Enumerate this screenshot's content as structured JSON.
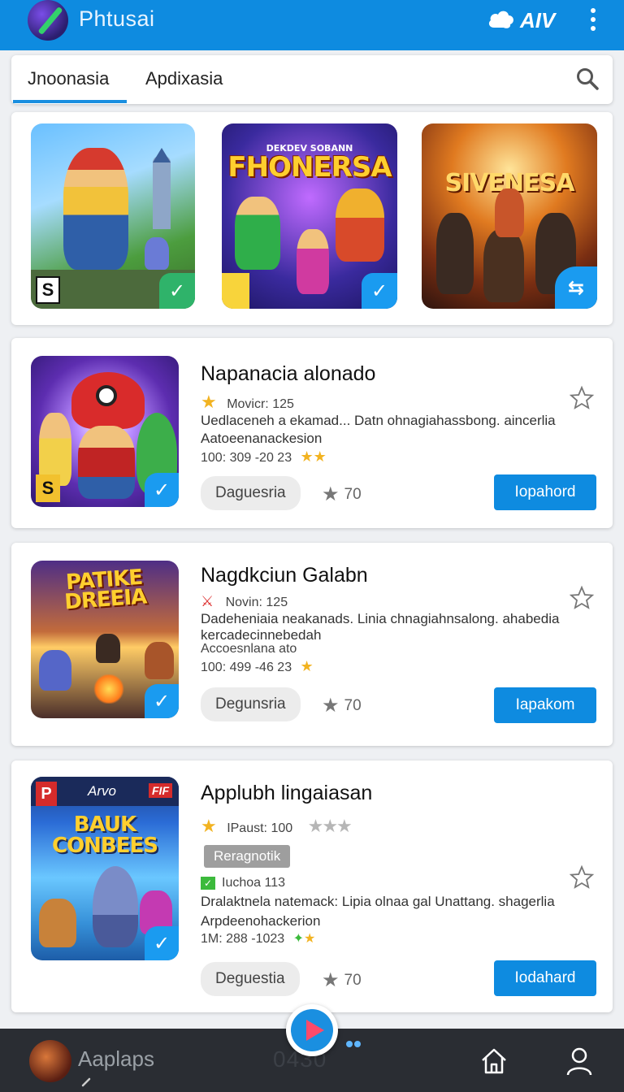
{
  "header": {
    "title": "Phtusai",
    "brand_mark": "AIV"
  },
  "tabs": [
    {
      "label": "Jnoonasia",
      "active": true
    },
    {
      "label": "Apdixasia",
      "active": false
    }
  ],
  "featured": {
    "tile2_subtitle": "DEKDEV SOBANN",
    "tile2_title": "FHONERSA",
    "tile3_title": "SIVENESA",
    "tile1_badge": "S"
  },
  "apps": [
    {
      "title": "Napanacia alonado",
      "meta": "Movicr: 125",
      "desc1": "Uedlaceneh a ekamad... Datn ohnagiahassbong. aincerlia",
      "desc2": "Aatoeenanackesion",
      "date": "100: 309 -20 23",
      "badge": "S",
      "tag": "Daguesria",
      "rating": "70",
      "action": "Iopahord"
    },
    {
      "title": "Nagdkciun Galabn",
      "thumb_title": "PATIKE DREEIA",
      "meta": "Novin: 125",
      "desc1": "Dadeheniaia neakanads. Linia chnagiahnsalong. ahabedia",
      "desc2": "kercadecinnebedah",
      "desc3": "Accoesnlana ato",
      "date": "100: 499 -46 23",
      "tag": "Degunsria",
      "rating": "70",
      "action": "Iapakom"
    },
    {
      "title": "Applubh lingaiasan",
      "thumb_header_logo": "P",
      "thumb_header_mid": "Arvo",
      "thumb_header_right": "FIF",
      "thumb_title": "BAUK CONBEES",
      "meta": "IPaust: 100",
      "pill": "Reragnotik",
      "meta2": "Iuchoa 113",
      "desc1": "Dralaktnela natemack: Lipia olnaa gal Unattang. shagerlia",
      "desc2": "Arpdeenohackerion",
      "date": "1M: 288 -1023",
      "tag": "Deguestia",
      "rating": "70",
      "action": "Iodahard"
    }
  ],
  "bottom": {
    "label": "Aaplaps",
    "count": "0430"
  },
  "colors": {
    "primary": "#0e8be0",
    "bottom_bar": "#2a2d33",
    "star": "#f2b321"
  }
}
